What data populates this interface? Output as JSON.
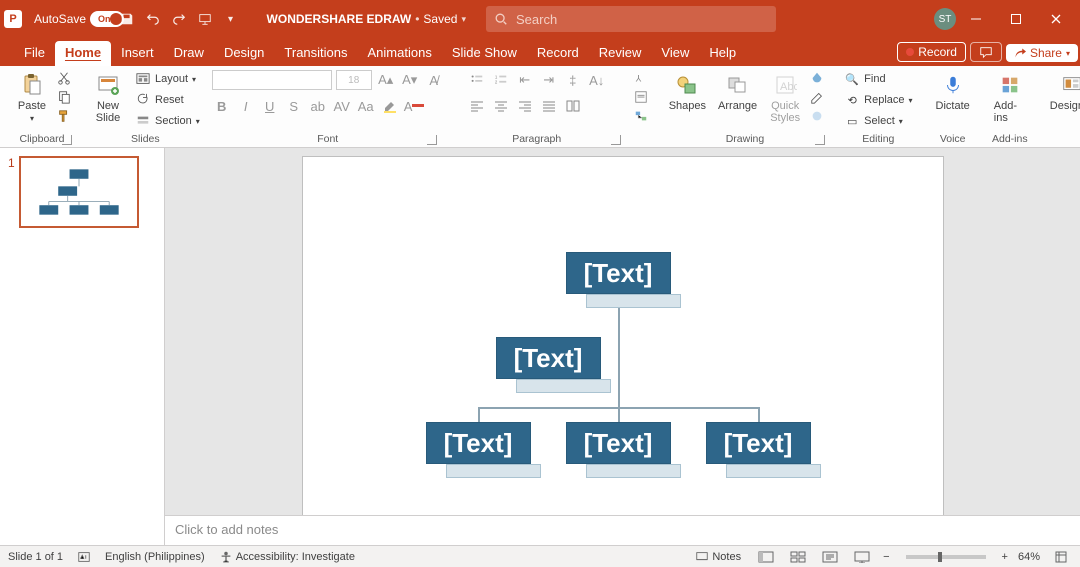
{
  "titlebar": {
    "autosave_label": "AutoSave",
    "autosave_state": "On",
    "doc_title": "WONDERSHARE EDRAW",
    "save_status": "Saved",
    "search_placeholder": "Search",
    "user_initials": "ST"
  },
  "tabs": {
    "file": "File",
    "home": "Home",
    "insert": "Insert",
    "draw": "Draw",
    "design": "Design",
    "transitions": "Transitions",
    "animations": "Animations",
    "slideshow": "Slide Show",
    "record": "Record",
    "review": "Review",
    "view": "View",
    "help": "Help",
    "record_btn": "Record",
    "share_btn": "Share"
  },
  "ribbon": {
    "clipboard": {
      "paste": "Paste",
      "label": "Clipboard"
    },
    "slides": {
      "new_slide": "New\nSlide",
      "layout": "Layout",
      "reset": "Reset",
      "section": "Section",
      "label": "Slides"
    },
    "font": {
      "size_placeholder": "18",
      "label": "Font"
    },
    "paragraph": {
      "label": "Paragraph"
    },
    "drawing": {
      "shapes": "Shapes",
      "arrange": "Arrange",
      "quick": "Quick\nStyles",
      "label": "Drawing"
    },
    "editing": {
      "find": "Find",
      "replace": "Replace",
      "select": "Select",
      "label": "Editing"
    },
    "voice": {
      "dictate": "Dictate",
      "label": "Voice"
    },
    "addins": {
      "addins": "Add-ins",
      "label": "Add-ins"
    },
    "designer": {
      "designer": "Designer"
    }
  },
  "thumbs": {
    "num": "1"
  },
  "slide": {
    "nodes": {
      "n1": "[Text]",
      "n2": "[Text]",
      "n3": "[Text]",
      "n4": "[Text]",
      "n5": "[Text]"
    }
  },
  "notes": {
    "placeholder": "Click to add notes"
  },
  "status": {
    "slide_counter": "Slide 1 of 1",
    "language": "English (Philippines)",
    "accessibility": "Accessibility: Investigate",
    "notes_btn": "Notes",
    "zoom": "64%"
  },
  "chart_data": {
    "type": "tree-hierarchy",
    "title": "",
    "nodes": [
      {
        "id": "n1",
        "label": "[Text]",
        "sublabel": "",
        "parent": null,
        "level": 0
      },
      {
        "id": "n2",
        "label": "[Text]",
        "sublabel": "",
        "parent": "n1",
        "level": 1
      },
      {
        "id": "n3",
        "label": "[Text]",
        "sublabel": "",
        "parent": "n2",
        "level": 2
      },
      {
        "id": "n4",
        "label": "[Text]",
        "sublabel": "",
        "parent": "n2",
        "level": 2
      },
      {
        "id": "n5",
        "label": "[Text]",
        "sublabel": "",
        "parent": "n2",
        "level": 2
      }
    ]
  }
}
